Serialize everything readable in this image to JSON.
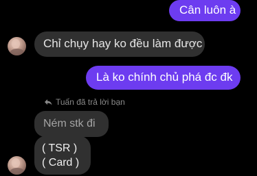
{
  "conversation": {
    "messages": [
      {
        "direction": "outgoing",
        "text": "Cân luôn à"
      },
      {
        "direction": "incoming",
        "text": "Chỉ chụy hay ko đều làm được"
      },
      {
        "direction": "outgoing",
        "text": "Là ko chính chủ phá đc đk"
      },
      {
        "direction": "incoming",
        "text": "Ném stk đi",
        "style": "quoted"
      },
      {
        "direction": "incoming",
        "lines": [
          "( TSR )",
          "( Card )"
        ]
      }
    ],
    "reply_hint": "Tuấn đã trả lời bạn"
  },
  "colors": {
    "background": "#000000",
    "outgoing_bubble": "#6d3cf0",
    "incoming_bubble": "#303030",
    "reply_hint_text": "#8a8a8a"
  },
  "icons": {
    "reply": "reply-arrow-icon",
    "avatar": "contact-avatar"
  }
}
